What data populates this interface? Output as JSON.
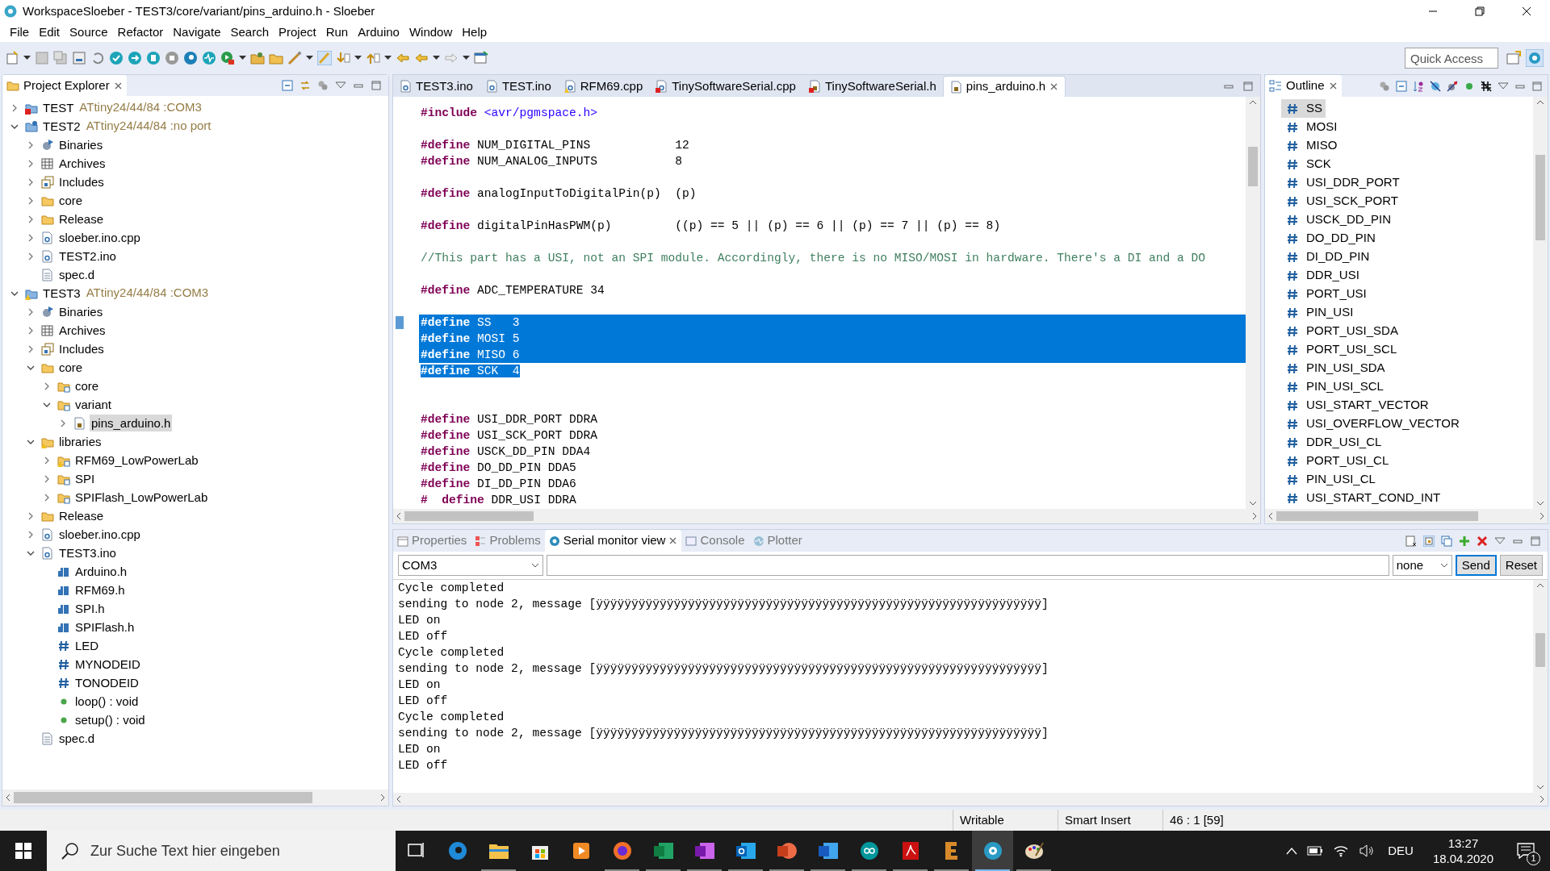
{
  "window": {
    "title": "WorkspaceSloeber - TEST3/core/variant/pins_arduino.h - Sloeber"
  },
  "menu": [
    "File",
    "Edit",
    "Source",
    "Refactor",
    "Navigate",
    "Search",
    "Project",
    "Run",
    "Arduino",
    "Window",
    "Help"
  ],
  "quick_access": {
    "placeholder": "Quick Access"
  },
  "project_explorer": {
    "title": "Project Explorer",
    "tree": [
      {
        "label": "TEST",
        "detail": "ATtiny24/44/84 :COM3",
        "kind": "project-error",
        "expanded": false,
        "selected": false
      },
      {
        "label": "TEST2",
        "detail": "ATtiny24/44/84 :no port",
        "kind": "project",
        "expanded": true,
        "selected": false,
        "children": [
          {
            "label": "Binaries",
            "kind": "binaries",
            "expanded": false,
            "selected": false
          },
          {
            "label": "Archives",
            "kind": "archives",
            "expanded": false,
            "selected": false
          },
          {
            "label": "Includes",
            "kind": "includes",
            "expanded": false,
            "selected": false
          },
          {
            "label": "core",
            "kind": "folder",
            "expanded": false,
            "selected": false
          },
          {
            "label": "Release",
            "kind": "folder",
            "expanded": false,
            "selected": false
          },
          {
            "label": "sloeber.ino.cpp",
            "kind": "file-c",
            "expanded": false,
            "selected": false
          },
          {
            "label": "TEST2.ino",
            "kind": "file-c",
            "expanded": false,
            "selected": false
          },
          {
            "label": "spec.d",
            "kind": "text-file",
            "selected": false
          }
        ]
      },
      {
        "label": "TEST3",
        "detail": "ATtiny24/44/84 :COM3",
        "kind": "project-warning",
        "expanded": true,
        "selected": false,
        "children": [
          {
            "label": "Binaries",
            "kind": "binaries",
            "expanded": false,
            "selected": false
          },
          {
            "label": "Archives",
            "kind": "archives",
            "expanded": false,
            "selected": false
          },
          {
            "label": "Includes",
            "kind": "includes",
            "expanded": false,
            "selected": false
          },
          {
            "label": "core",
            "kind": "folder",
            "expanded": true,
            "selected": false,
            "children": [
              {
                "label": "core",
                "kind": "linked-folder",
                "expanded": false,
                "selected": false
              },
              {
                "label": "variant",
                "kind": "linked-folder",
                "expanded": true,
                "selected": false,
                "children": [
                  {
                    "label": "pins_arduino.h",
                    "kind": "file-h",
                    "expanded": false,
                    "selected": true
                  }
                ]
              }
            ]
          },
          {
            "label": "libraries",
            "kind": "folder-warning",
            "expanded": true,
            "selected": false,
            "children": [
              {
                "label": "RFM69_LowPowerLab",
                "kind": "linked-folder-warning",
                "expanded": false,
                "selected": false
              },
              {
                "label": "SPI",
                "kind": "linked-folder",
                "expanded": false,
                "selected": false
              },
              {
                "label": "SPIFlash_LowPowerLab",
                "kind": "linked-folder",
                "expanded": false,
                "selected": false
              }
            ]
          },
          {
            "label": "Release",
            "kind": "folder",
            "expanded": false,
            "selected": false
          },
          {
            "label": "sloeber.ino.cpp",
            "kind": "file-c",
            "expanded": false,
            "selected": false
          },
          {
            "label": "TEST3.ino",
            "kind": "file-c",
            "expanded": true,
            "selected": false,
            "children": [
              {
                "label": "Arduino.h",
                "kind": "header-ref",
                "selected": false
              },
              {
                "label": "RFM69.h",
                "kind": "header-ref",
                "selected": false
              },
              {
                "label": "SPI.h",
                "kind": "header-ref",
                "selected": false
              },
              {
                "label": "SPIFlash.h",
                "kind": "header-ref",
                "selected": false
              },
              {
                "label": "LED",
                "kind": "macro",
                "selected": false
              },
              {
                "label": "MYNODEID",
                "kind": "macro",
                "selected": false
              },
              {
                "label": "TONODEID",
                "kind": "macro",
                "selected": false
              },
              {
                "label": "loop() : void",
                "kind": "function",
                "selected": false
              },
              {
                "label": "setup() : void",
                "kind": "function",
                "selected": false
              }
            ]
          },
          {
            "label": "spec.d",
            "kind": "text-file",
            "selected": false
          }
        ]
      }
    ]
  },
  "editor": {
    "tabs": [
      {
        "label": "TEST3.ino",
        "kind": "c",
        "selected": false
      },
      {
        "label": "TEST.ino",
        "kind": "c",
        "selected": false
      },
      {
        "label": "RFM69.cpp",
        "kind": "c-warning",
        "selected": false
      },
      {
        "label": "TinySoftwareSerial.cpp",
        "kind": "c-error",
        "selected": false
      },
      {
        "label": "TinySoftwareSerial.h",
        "kind": "h-error",
        "selected": false
      },
      {
        "label": "pins_arduino.h",
        "kind": "h",
        "selected": true
      }
    ],
    "blocks": [
      {
        "kind": "first",
        "lines": [
          {
            "kind": "directive",
            "keyword": "#include",
            "string": "<avr/pgmspace.h>",
            "selected": false
          }
        ]
      },
      {
        "kind": "normal",
        "lines": [
          {
            "kind": "directive",
            "keyword": "#define",
            "text": "NUM_DIGITAL_PINS            12",
            "selected": false
          },
          {
            "kind": "directive",
            "keyword": "#define",
            "text": "NUM_ANALOG_INPUTS           8",
            "selected": false
          }
        ]
      },
      {
        "kind": "normal",
        "lines": [
          {
            "kind": "directive",
            "keyword": "#define",
            "text": "analogInputToDigitalPin(p)  (p)",
            "selected": false
          }
        ]
      },
      {
        "kind": "normal",
        "lines": [
          {
            "kind": "directive",
            "keyword": "#define",
            "text": "digitalPinHasPWM(p)         ((p) == 5 || (p) == 6 || (p) == 7 || (p) == 8)",
            "selected": false
          }
        ]
      },
      {
        "kind": "normal",
        "lines": [
          {
            "kind": "comment",
            "text": "//This part has a USI, not an SPI module. Accordingly, there is no MISO/MOSI in hardware. There's a DI and a DO",
            "selected": false
          }
        ]
      },
      {
        "kind": "normal",
        "lines": [
          {
            "kind": "directive",
            "keyword": "#define",
            "text": "ADC_TEMPERATURE 34",
            "selected": false
          }
        ]
      },
      {
        "kind": "normal",
        "lines": [
          {
            "kind": "directive",
            "keyword": "#define",
            "text": "SS   3",
            "selected": true
          },
          {
            "kind": "directive",
            "keyword": "#define",
            "text": "MOSI 5",
            "selected": true
          },
          {
            "kind": "directive",
            "keyword": "#define",
            "text": "MISO 6",
            "selected": true
          },
          {
            "kind": "directive",
            "keyword": "#define",
            "text": "SCK  4",
            "selected": true
          }
        ]
      },
      {
        "kind": "spaced",
        "lines": [
          {
            "kind": "directive",
            "keyword": "#define",
            "text": "USI_DDR_PORT DDRA",
            "selected": false
          },
          {
            "kind": "directive",
            "keyword": "#define",
            "text": "USI_SCK_PORT DDRA",
            "selected": false
          },
          {
            "kind": "directive",
            "keyword": "#define",
            "text": "USCK_DD_PIN DDA4",
            "selected": false
          },
          {
            "kind": "directive",
            "keyword": "#define",
            "text": "DO_DD_PIN DDA5",
            "selected": false
          },
          {
            "kind": "directive",
            "keyword": "#define",
            "text": "DI_DD_PIN DDA6",
            "selected": false
          },
          {
            "kind": "directive",
            "keyword": "#  define",
            "text": "DDR_USI DDRA",
            "selected": false
          }
        ]
      }
    ]
  },
  "outline": {
    "title": "Outline",
    "items": [
      {
        "label": "SS",
        "selected": true
      },
      {
        "label": "MOSI",
        "selected": false
      },
      {
        "label": "MISO",
        "selected": false
      },
      {
        "label": "SCK",
        "selected": false
      },
      {
        "label": "USI_DDR_PORT",
        "selected": false
      },
      {
        "label": "USI_SCK_PORT",
        "selected": false
      },
      {
        "label": "USCK_DD_PIN",
        "selected": false
      },
      {
        "label": "DO_DD_PIN",
        "selected": false
      },
      {
        "label": "DI_DD_PIN",
        "selected": false
      },
      {
        "label": "DDR_USI",
        "selected": false
      },
      {
        "label": "PORT_USI",
        "selected": false
      },
      {
        "label": "PIN_USI",
        "selected": false
      },
      {
        "label": "PORT_USI_SDA",
        "selected": false
      },
      {
        "label": "PORT_USI_SCL",
        "selected": false
      },
      {
        "label": "PIN_USI_SDA",
        "selected": false
      },
      {
        "label": "PIN_USI_SCL",
        "selected": false
      },
      {
        "label": "USI_START_VECTOR",
        "selected": false
      },
      {
        "label": "USI_OVERFLOW_VECTOR",
        "selected": false
      },
      {
        "label": "DDR_USI_CL",
        "selected": false
      },
      {
        "label": "PORT_USI_CL",
        "selected": false
      },
      {
        "label": "PIN_USI_CL",
        "selected": false
      },
      {
        "label": "USI_START_COND_INT",
        "selected": false
      }
    ]
  },
  "bottom_panel": {
    "tabs": [
      {
        "label": "Properties",
        "kind": "properties",
        "selected": false
      },
      {
        "label": "Problems",
        "kind": "problems",
        "selected": false
      },
      {
        "label": "Serial monitor view",
        "kind": "serial",
        "selected": true
      },
      {
        "label": "Console",
        "kind": "console",
        "selected": false
      },
      {
        "label": "Plotter",
        "kind": "plotter",
        "selected": false
      }
    ],
    "port": "COM3",
    "line_ending": "none",
    "buttons": [
      "Send",
      "Reset"
    ],
    "output": [
      "Cycle completed",
      "sending to node 2, message [ÿÿÿÿÿÿÿÿÿÿÿÿÿÿÿÿÿÿÿÿÿÿÿÿÿÿÿÿÿÿÿÿÿÿÿÿÿÿÿÿÿÿÿÿÿÿÿÿÿÿÿÿÿÿÿÿÿÿÿÿÿÿÿ]",
      "LED on",
      "LED off",
      "Cycle completed",
      "sending to node 2, message [ÿÿÿÿÿÿÿÿÿÿÿÿÿÿÿÿÿÿÿÿÿÿÿÿÿÿÿÿÿÿÿÿÿÿÿÿÿÿÿÿÿÿÿÿÿÿÿÿÿÿÿÿÿÿÿÿÿÿÿÿÿÿÿ]",
      "LED on",
      "LED off",
      "Cycle completed",
      "sending to node 2, message [ÿÿÿÿÿÿÿÿÿÿÿÿÿÿÿÿÿÿÿÿÿÿÿÿÿÿÿÿÿÿÿÿÿÿÿÿÿÿÿÿÿÿÿÿÿÿÿÿÿÿÿÿÿÿÿÿÿÿÿÿÿÿÿ]",
      "LED on",
      "LED off"
    ]
  },
  "status_bar": [
    "Writable",
    "Smart Insert",
    "46 : 1 [59]"
  ],
  "taskbar": {
    "search_placeholder": "Zur Suche Text hier eingeben",
    "language": "DEU",
    "time": "13:27",
    "date": "18.04.2020",
    "notification_count": "1"
  }
}
